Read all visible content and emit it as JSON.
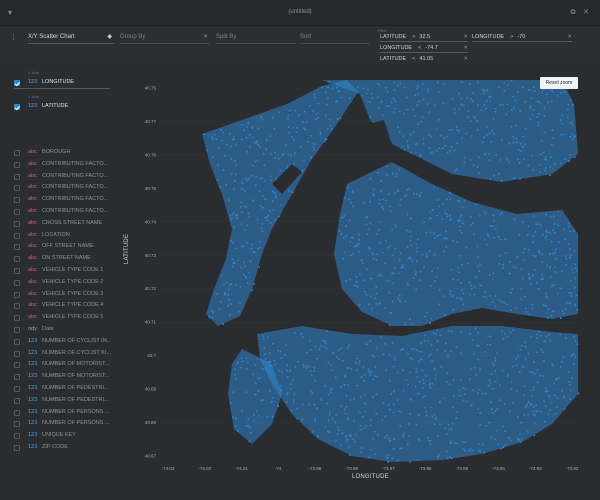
{
  "window": {
    "title": "(untitled)"
  },
  "toolbar": {
    "chart_type": "X/Y Scatter Chart",
    "group_by": "Group By",
    "split_by": "Split By",
    "sort": "Sort",
    "filter_label": "Filter",
    "filters": [
      {
        "column": "LATITUDE",
        "op": ">",
        "value": "32.5"
      },
      {
        "column": "LONGITUDE",
        "op": ">",
        "value": "-70"
      },
      {
        "column": "LONGITUDE",
        "op": "<",
        "value": "-74.7"
      },
      {
        "column": "LATITUDE",
        "op": "<",
        "value": "41.05"
      }
    ]
  },
  "sidebar": {
    "x_axis_label": "X Axis",
    "x_axis": {
      "type": "123",
      "name": "LONGITUDE"
    },
    "y_axis_label": "Y Axis",
    "y_axis": {
      "type": "123",
      "name": "LATITUDE"
    },
    "columns": [
      {
        "type": "abc",
        "kind": "str",
        "name": "BOROUGH"
      },
      {
        "type": "abc",
        "kind": "str",
        "name": "CONTRIBUTING FACTO..."
      },
      {
        "type": "abc",
        "kind": "str",
        "name": "CONTRIBUTING FACTO..."
      },
      {
        "type": "abc",
        "kind": "str",
        "name": "CONTRIBUTING FACTO..."
      },
      {
        "type": "abc",
        "kind": "str",
        "name": "CONTRIBUTING FACTO..."
      },
      {
        "type": "abc",
        "kind": "str",
        "name": "CONTRIBUTING FACTO..."
      },
      {
        "type": "abc",
        "kind": "str",
        "name": "CROSS STREET NAME"
      },
      {
        "type": "abc",
        "kind": "str",
        "name": "LOCATION"
      },
      {
        "type": "abc",
        "kind": "str",
        "name": "OFF STREET NAME"
      },
      {
        "type": "abc",
        "kind": "str",
        "name": "ON STREET NAME"
      },
      {
        "type": "abc",
        "kind": "str",
        "name": "VEHICLE TYPE CODE 1"
      },
      {
        "type": "abc",
        "kind": "str",
        "name": "VEHICLE TYPE CODE 2"
      },
      {
        "type": "abc",
        "kind": "str",
        "name": "VEHICLE TYPE CODE 3"
      },
      {
        "type": "abc",
        "kind": "str",
        "name": "VEHICLE TYPE CODE 4"
      },
      {
        "type": "abc",
        "kind": "str",
        "name": "VEHICLE TYPE CODE 5"
      },
      {
        "type": "ody",
        "kind": "date",
        "name": "Date"
      },
      {
        "type": "123",
        "kind": "num",
        "name": "NUMBER OF CYCLIST IN..."
      },
      {
        "type": "123",
        "kind": "num",
        "name": "NUMBER OF CYCLIST KI..."
      },
      {
        "type": "123",
        "kind": "num",
        "name": "NUMBER OF MOTORIST..."
      },
      {
        "type": "123",
        "kind": "num",
        "name": "NUMBER OF MOTORIST..."
      },
      {
        "type": "123",
        "kind": "num",
        "name": "NUMBER OF PEDESTRI..."
      },
      {
        "type": "123",
        "kind": "num",
        "name": "NUMBER OF PEDESTRI..."
      },
      {
        "type": "123",
        "kind": "num",
        "name": "NUMBER OF PERSONS ..."
      },
      {
        "type": "123",
        "kind": "num",
        "name": "NUMBER OF PERSONS ..."
      },
      {
        "type": "123",
        "kind": "num",
        "name": "UNIQUE KEY"
      },
      {
        "type": "123",
        "kind": "num",
        "name": "ZIP CODE"
      }
    ]
  },
  "chart": {
    "reset_zoom": "Reset zoom",
    "xlabel": "LONGITUDE",
    "ylabel": "LATITUDE",
    "accent": "#2f86d0"
  },
  "chart_data": {
    "type": "scatter",
    "xlabel": "LONGITUDE",
    "ylabel": "LATITUDE",
    "xlim": [
      -74.03,
      -73.77
    ],
    "ylim": [
      40.665,
      40.775
    ],
    "x_ticks": [
      "-74.03",
      "-74.02",
      "-74.01",
      "-74",
      "-73.99",
      "-73.98",
      "-73.97",
      "-73.96",
      "-73.95",
      "-73.94",
      "-73.93",
      "-73.92",
      "-73.91",
      "-73.9",
      "-73.89",
      "-73.88",
      "-73.87",
      "-73.86",
      "-73.85",
      "-73.84",
      "-73.83",
      "-73.82",
      "-73.81",
      "-73.8",
      "-73.79",
      "-73.78",
      "-73.77"
    ],
    "x_tick_labels_shown": [
      "-74.03",
      "-74.02",
      "-74.01",
      "-74",
      "-73.99",
      "-73.98",
      "-73.97",
      "-73.96",
      "-73.95",
      "-73.94",
      "-73.93",
      "-73.92"
    ],
    "y_ticks": [
      "40.75",
      "40.77",
      "40.76",
      "40.75",
      "40.74",
      "40.73",
      "40.72",
      "40.71",
      "40.7",
      "40.69",
      "40.68",
      "40.67"
    ],
    "series": [
      {
        "name": "",
        "color": "#2f86d0"
      }
    ],
    "grid": true,
    "legend": "none"
  }
}
